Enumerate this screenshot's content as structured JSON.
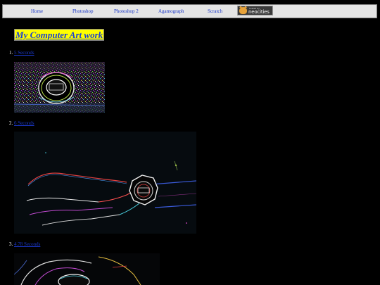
{
  "nav": {
    "items": [
      {
        "label": "Home"
      },
      {
        "label": "Photoshop"
      },
      {
        "label": "Photoshop 2"
      },
      {
        "label": "Agamograph"
      },
      {
        "label": "Scratch"
      }
    ],
    "badge": {
      "small_text": "hosted by",
      "brand_text": "neocities",
      "icon": "neocities-cat-icon"
    }
  },
  "page": {
    "title": "My Computer Art work"
  },
  "artworks": [
    {
      "number": "1.",
      "link_text": "5 Seconds"
    },
    {
      "number": "2.",
      "link_text": "6 Seconds"
    },
    {
      "number": "3.",
      "link_text": "4.78 Seconds"
    }
  ],
  "colors": {
    "background": "#000000",
    "nav_background": "#e4e4e4",
    "link": "#1a37c8",
    "title_background": "#ffff00",
    "title_text": "#1a3fd0"
  }
}
